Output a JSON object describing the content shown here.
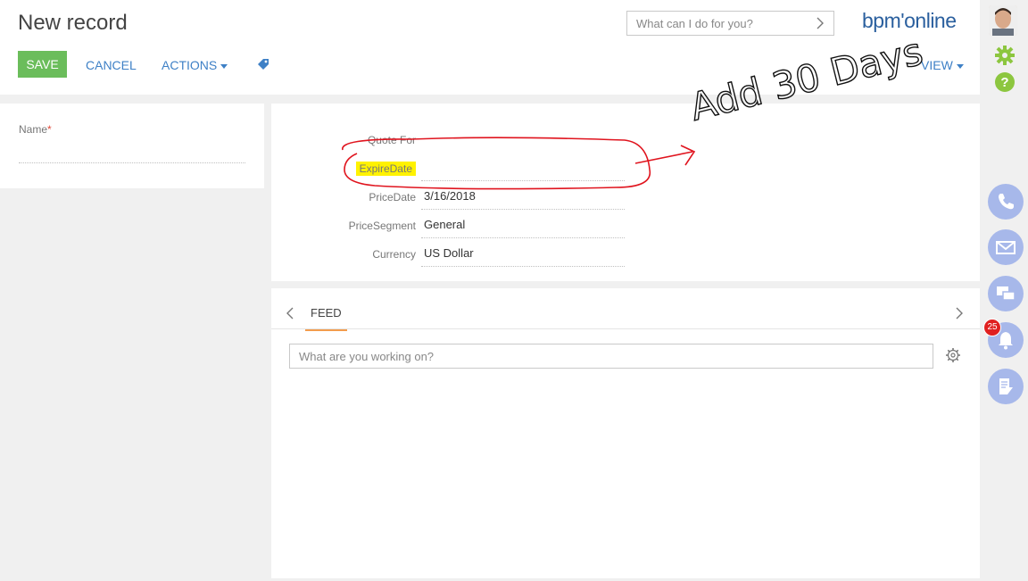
{
  "header": {
    "title": "New record",
    "save_label": "SAVE",
    "cancel_label": "CANCEL",
    "actions_label": "ACTIONS",
    "view_label": "VIEW",
    "search_placeholder": "What can I do for you?",
    "logo": "bpm'online"
  },
  "left_panel": {
    "name_label": "Name",
    "name_required_mark": "*"
  },
  "fields": [
    {
      "label": "Quote For",
      "value": ""
    },
    {
      "label": "ExpireDate",
      "value": ""
    },
    {
      "label": "PriceDate",
      "value": "3/16/2018"
    },
    {
      "label": "PriceSegment",
      "value": "General"
    },
    {
      "label": "Currency",
      "value": "US Dollar"
    }
  ],
  "feed": {
    "tab_label": "FEED",
    "input_placeholder": "What are you working on?"
  },
  "sidebar": {
    "notifications_count": "25"
  },
  "annotation": {
    "text": "Add 30 Days"
  },
  "colors": {
    "accent": "#3e80c6",
    "save": "#6bbd5b",
    "tab_underline": "#f39c4d",
    "sidebar_circle": "#a7b8ea",
    "gear": "#8cc63f",
    "help": "#8cc63f",
    "badge": "#e02020",
    "highlight": "#fff200",
    "annotation_red": "#e0141e"
  }
}
